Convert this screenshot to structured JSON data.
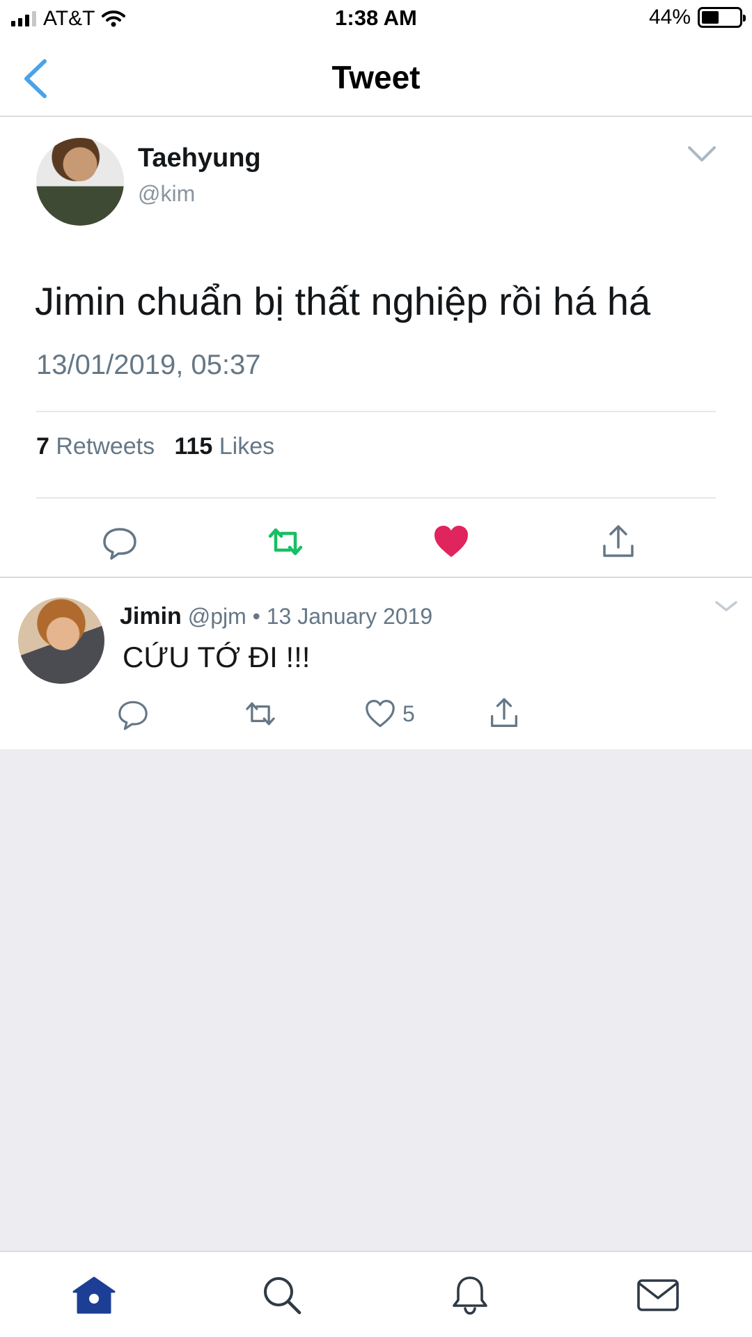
{
  "status_bar": {
    "carrier": "AT&T",
    "time": "1:38 AM",
    "battery": "44%",
    "battery_level": 0.44
  },
  "nav": {
    "title": "Tweet",
    "back_icon": "chevron-left-icon"
  },
  "tweet": {
    "author_name": "Taehyung",
    "author_handle": "@kim",
    "text": "Jimin chuẩn bị thất nghiệp rồi há há",
    "timestamp": "13/01/2019, 05:37",
    "retweets_count": "7",
    "retweets_label": "Retweets",
    "likes_count": "115",
    "likes_label": "Likes",
    "liked": true,
    "colors": {
      "retweet": "#17bf63",
      "like": "#e0245e",
      "accent": "#4aa3e8"
    }
  },
  "reply": {
    "author_name": "Jimin",
    "author_handle": "@pjm",
    "separator": "•",
    "date": "13 January 2019",
    "text": "CỨU TỚ ĐI !!!",
    "like_count": "5"
  },
  "tabbar": {
    "items": [
      "home-icon",
      "search-icon",
      "bell-icon",
      "mail-icon"
    ],
    "active_color": "#1c3f95",
    "inactive_color": "#2f3a45"
  }
}
